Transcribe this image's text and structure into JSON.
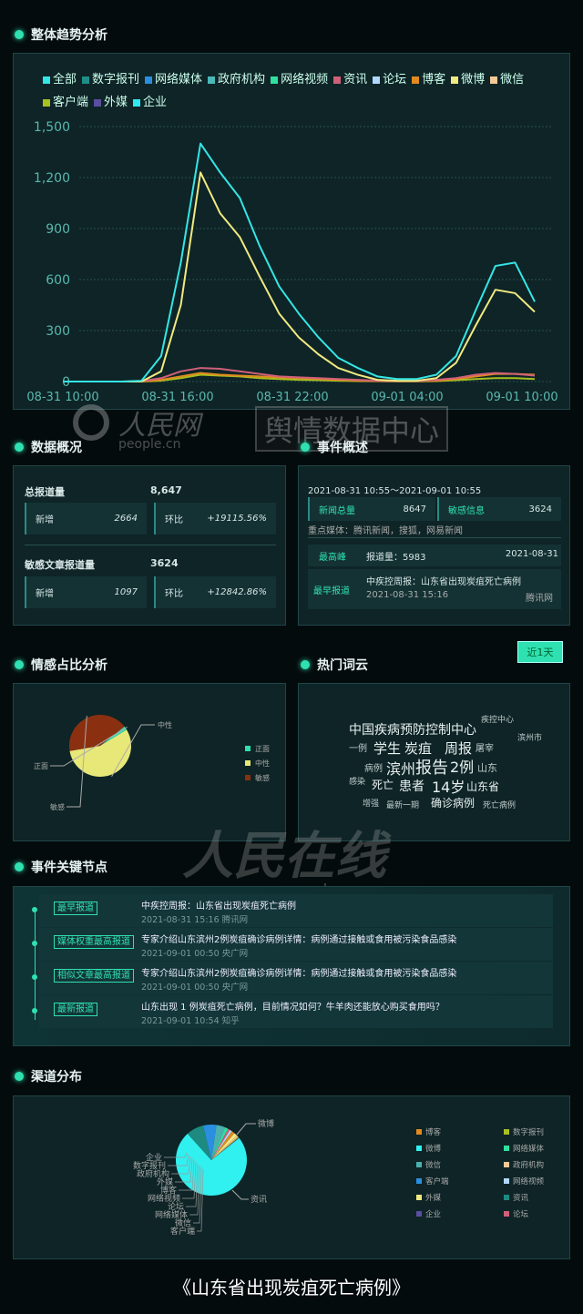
{
  "sections": {
    "trend": "整体趋势分析",
    "overview": "数据概况",
    "event": "事件概述",
    "sentiment": "情感占比分析",
    "wordcloud": "热门词云",
    "nodes": "事件关键节点",
    "channel": "渠道分布"
  },
  "watermark": {
    "top_logo": "人民网",
    "top_url": "people.cn",
    "top_badge": "舆情数据中心",
    "mid_logo": "人民在线",
    "mid_url": "www.peopleyun.cn"
  },
  "chart_data": [
    {
      "type": "line",
      "xlabel": "",
      "ylabel": "",
      "ylim": [
        0,
        1500
      ],
      "yticks": [
        "0",
        "300",
        "600",
        "900",
        "1,200",
        "1,500"
      ],
      "grid": true,
      "legend": "top",
      "x": [
        "08-31 10:00",
        "11:00",
        "12:00",
        "13:00",
        "14:00",
        "15:00",
        "08-31 16:00",
        "17:00",
        "18:00",
        "19:00",
        "20:00",
        "21:00",
        "08-31 22:00",
        "23:00",
        "00:00",
        "01:00",
        "02:00",
        "03:00",
        "09-01 04:00",
        "05:00",
        "06:00",
        "07:00",
        "08:00",
        "09:00",
        "09-01 10:00"
      ],
      "xticks": [
        "08-31 10:00",
        "08-31 16:00",
        "08-31 22:00",
        "09-01 04:00",
        "09-01 10:00"
      ],
      "legend_items": [
        {
          "name": "全部",
          "color": "#34e6e6"
        },
        {
          "name": "数字报刊",
          "color": "#1e8f88"
        },
        {
          "name": "网络媒体",
          "color": "#2a8fe0"
        },
        {
          "name": "政府机构",
          "color": "#4ab8b8"
        },
        {
          "name": "网络视频",
          "color": "#2fe0a0"
        },
        {
          "name": "资讯",
          "color": "#d0607a"
        },
        {
          "name": "论坛",
          "color": "#b0d8ff"
        },
        {
          "name": "博客",
          "color": "#e08a20"
        },
        {
          "name": "微博",
          "color": "#f0ea80"
        },
        {
          "name": "微信",
          "color": "#f5c898"
        },
        {
          "name": "客户端",
          "color": "#a8c020"
        },
        {
          "name": "外媒",
          "color": "#5a4ea0"
        },
        {
          "name": "企业",
          "color": "#30e8f0"
        }
      ],
      "series": [
        {
          "name": "全部",
          "values": [
            0,
            0,
            0,
            0,
            5,
            150,
            700,
            1400,
            1230,
            1080,
            800,
            560,
            400,
            260,
            140,
            80,
            30,
            15,
            15,
            40,
            150,
            420,
            680,
            700,
            470
          ]
        },
        {
          "name": "微博",
          "values": [
            0,
            0,
            0,
            0,
            0,
            60,
            450,
            1230,
            990,
            850,
            620,
            400,
            260,
            160,
            80,
            40,
            10,
            5,
            5,
            20,
            110,
            330,
            540,
            520,
            410
          ]
        },
        {
          "name": "资讯",
          "values": [
            0,
            0,
            0,
            0,
            2,
            20,
            60,
            80,
            75,
            60,
            45,
            30,
            25,
            20,
            15,
            10,
            5,
            3,
            3,
            10,
            20,
            40,
            50,
            45,
            35
          ]
        },
        {
          "name": "博客",
          "values": [
            0,
            0,
            0,
            0,
            0,
            10,
            30,
            50,
            40,
            35,
            30,
            25,
            20,
            15,
            10,
            5,
            3,
            2,
            2,
            5,
            15,
            30,
            45,
            45,
            40
          ]
        },
        {
          "name": "客户端",
          "values": [
            0,
            0,
            0,
            0,
            0,
            5,
            20,
            40,
            35,
            30,
            20,
            15,
            10,
            8,
            5,
            3,
            2,
            1,
            1,
            3,
            8,
            15,
            20,
            20,
            15
          ]
        }
      ]
    },
    {
      "type": "pie",
      "categories": [
        "正面",
        "中性",
        "敏感"
      ],
      "values": [
        2,
        56,
        42
      ],
      "colors": [
        "#2fe0b0",
        "#e8e878",
        "#8a3010"
      ],
      "legend": "right"
    },
    {
      "type": "pie",
      "categories": [
        "微博",
        "资讯",
        "客户端",
        "微信",
        "网络媒体",
        "论坛",
        "网络视频",
        "博客",
        "外媒",
        "政府机构",
        "数字报刊",
        "企业"
      ],
      "values": [
        74,
        8,
        6,
        4,
        1.5,
        1,
        1,
        1.5,
        1.5,
        0.7,
        0.5,
        0.3
      ],
      "colors": [
        "#30f0f0",
        "#1e8a80",
        "#2a8fe0",
        "#4ab0b0",
        "#2fe0a0",
        "#d0607a",
        "#b0d8ff",
        "#e08a20",
        "#f0ea80",
        "#f5c898",
        "#a8c020",
        "#5a4ea0"
      ],
      "legend_items": [
        "博客",
        "数字报刊",
        "微博",
        "网络媒体",
        "微信",
        "政府机构",
        "客户端",
        "网络视频",
        "外媒",
        "资讯",
        "企业",
        "论坛"
      ],
      "legend": "right"
    }
  ],
  "overview": {
    "total_label": "总报道量",
    "total": "8,647",
    "new_label": "新增",
    "new1": "2664",
    "ratio_label": "环比",
    "ratio1": "+19115.56%",
    "sens_label": "敏感文章报道量",
    "sens": "3624",
    "new2": "1097",
    "ratio2": "+12842.86%"
  },
  "event": {
    "range": "2021-08-31 10:55～2021-09-01 10:55",
    "news_label": "新闻总量",
    "news": "8647",
    "sens_label": "敏感信息",
    "sens": "3624",
    "media": "重点媒体：腾讯新闻，搜狐，网易新闻",
    "peak_label": "最高峰",
    "peak_count": "报道量：5983",
    "peak_date": "2021-08-31",
    "first_label": "最早报道",
    "first_title": "中疾控周报：山东省出现炭疽死亡病例",
    "first_time": "2021-08-31 15:16",
    "first_src": "腾讯网"
  },
  "range_button": "近1天",
  "words": [
    "中国疾病预防控制中心",
    "疾控中心",
    "滨州市",
    "一例",
    "学生",
    "炭疽",
    "周报",
    "屠宰",
    "病例",
    "滨州",
    "报告",
    "2例",
    "山东",
    "感染",
    "死亡",
    "患者",
    "14岁",
    "山东省",
    "增强",
    "最新一期",
    "确诊病例",
    "死亡病例"
  ],
  "nodes": [
    {
      "tag": "最早报道",
      "title": "中疾控周报：山东省出现炭疽死亡病例",
      "meta": "2021-08-31 15:16 腾讯网"
    },
    {
      "tag": "媒体权重最高报道",
      "title": "专家介绍山东滨州2例炭疽确诊病例详情：病例通过接触或食用被污染食品感染",
      "meta": "2021-09-01 00:50 央广网"
    },
    {
      "tag": "相似文章最高报道",
      "title": "专家介绍山东滨州2例炭疽确诊病例详情：病例通过接触或食用被污染食品感染",
      "meta": "2021-09-01 00:50 央广网"
    },
    {
      "tag": "最新报道",
      "title": "山东出现 1 例炭疽死亡病例，目前情况如何？牛羊肉还能放心购买食用吗？",
      "meta": "2021-09-01 10:54 知乎"
    }
  ],
  "caption": "《山东省出现炭疽死亡病例》"
}
